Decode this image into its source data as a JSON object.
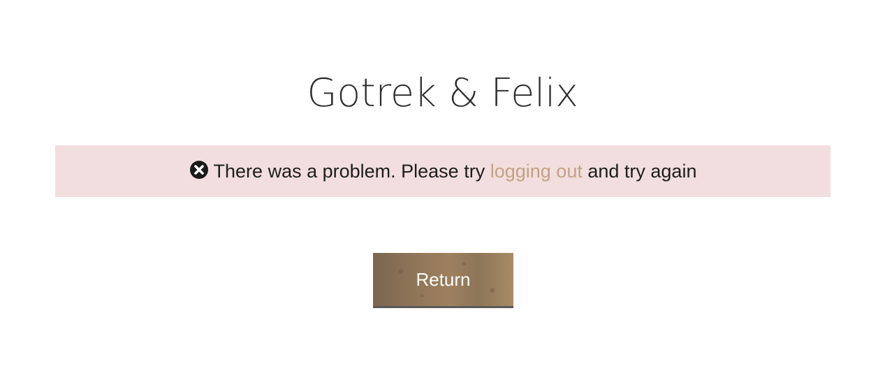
{
  "header": {
    "title": "Gotrek & Felix"
  },
  "alert": {
    "icon": "circle-x-icon",
    "text_before": "There was a problem. Please try",
    "link_text": "logging out",
    "text_after": "and try again",
    "background_color": "#f2dede",
    "link_color": "#c3a184"
  },
  "actions": {
    "return_label": "Return"
  }
}
